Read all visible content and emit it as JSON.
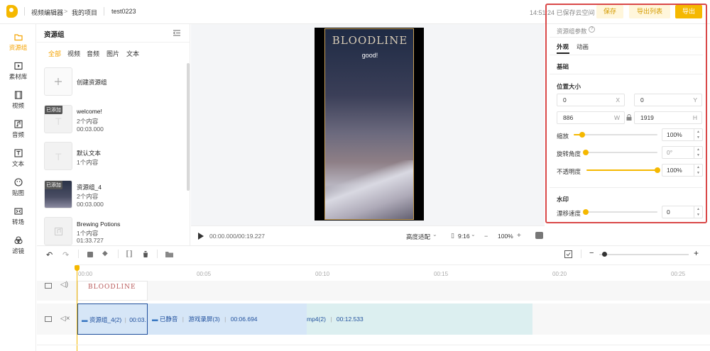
{
  "header": {
    "app_name": "视频编辑器",
    "breadcrumb_sep": ">",
    "project_label": "我的项目",
    "project_name": "test0223",
    "save_status": "14:51:24 已保存云空间",
    "save_label": "保存",
    "export_list_label": "导出列表",
    "export_label": "导出"
  },
  "nav": {
    "items": [
      {
        "label": "资源组",
        "icon": "folder-icon",
        "active": true
      },
      {
        "label": "素材库",
        "icon": "play-square-icon"
      },
      {
        "label": "视频",
        "icon": "film-icon"
      },
      {
        "label": "音频",
        "icon": "music-icon"
      },
      {
        "label": "文本",
        "icon": "text-icon"
      },
      {
        "label": "贴图",
        "icon": "sticker-icon"
      },
      {
        "label": "转场",
        "icon": "transition-icon"
      },
      {
        "label": "滤镜",
        "icon": "filter-icon"
      }
    ]
  },
  "resources": {
    "title": "资源组",
    "tabs": [
      "全部",
      "视频",
      "音频",
      "图片",
      "文本"
    ],
    "create_label": "创建资源组",
    "added_tag": "已添加",
    "items": [
      {
        "name": "welcome!",
        "count": "2个内容",
        "duration": "00:03.000",
        "added": true
      },
      {
        "name": "默认文本",
        "count": "1个内容",
        "added": false
      },
      {
        "name": "资源组_4",
        "count": "2个内容",
        "duration": "00:03.000",
        "added": true
      },
      {
        "name": "Brewing Potions",
        "count": "1个内容",
        "duration": "01:33.727",
        "added": false
      }
    ]
  },
  "preview": {
    "title_text": "BLOODLINE",
    "subtitle": "good!",
    "time": "00:00.000/00:19.227",
    "fit_label": "高度适配",
    "ratio": "9:16",
    "zoom": "100%"
  },
  "props": {
    "section_title": "资源组参数",
    "tabs": [
      "外观",
      "动画"
    ],
    "basic_label": "基础",
    "pos_size_label": "位置大小",
    "x_value": "0",
    "x_suffix": "X",
    "y_value": "0",
    "y_suffix": "Y",
    "w_value": "886",
    "w_suffix": "W",
    "h_value": "1919",
    "h_suffix": "H",
    "scale_label": "缩放",
    "scale_value": "100%",
    "scale_level": 0.1,
    "rotate_label": "旋转角度",
    "rotate_value": "0°",
    "rotate_level": 0,
    "opacity_label": "不透明度",
    "opacity_value": "100%",
    "opacity_level": 1,
    "watermark_label": "水印",
    "drift_label": "漂移速度",
    "drift_value": "0",
    "drift_level": 0
  },
  "timeline": {
    "ticks": [
      "00:00",
      "00:05",
      "00:10",
      "00:15",
      "00:20",
      "00:25"
    ],
    "track1_thumb": "BLOODLINE",
    "clips": [
      {
        "label": "资源组_4(2)",
        "time": "00:03."
      },
      {
        "label": "已静音",
        "sub": "游戏录屏(3)",
        "time": "00:06.694"
      },
      {
        "label": "mp4(2)",
        "time": "00:12.533"
      }
    ]
  },
  "colors": {
    "accent": "#f5b800",
    "highlight_frame": "#d94848",
    "clip_blue": "#d6e6f7",
    "clip_teal": "#dceff0"
  }
}
